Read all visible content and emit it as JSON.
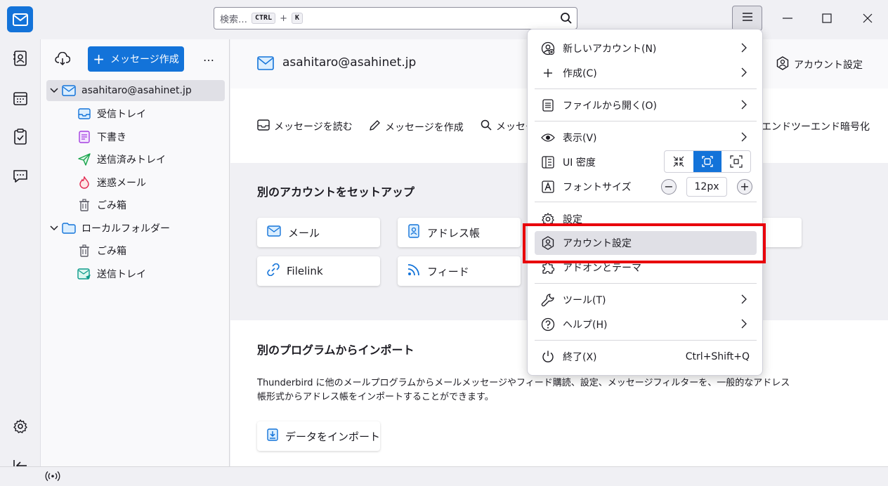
{
  "search": {
    "placeholder": "検索…",
    "key1": "CTRL",
    "plus": "+",
    "key2": "K"
  },
  "folder_pane": {
    "compose_label": "メッセージ作成",
    "more_label": "…",
    "account": "asahitaro@asahinet.jp",
    "folders": [
      {
        "label": "受信トレイ",
        "icon": "inbox-icon"
      },
      {
        "label": "下書き",
        "icon": "drafts-icon"
      },
      {
        "label": "送信済みトレイ",
        "icon": "sent-icon"
      },
      {
        "label": "迷惑メール",
        "icon": "junk-icon"
      },
      {
        "label": "ごみ箱",
        "icon": "trash-icon"
      }
    ],
    "local": "ローカルフォルダー",
    "local_folders": [
      {
        "label": "ごみ箱",
        "icon": "trash-icon"
      },
      {
        "label": "送信トレイ",
        "icon": "outbox-icon"
      }
    ]
  },
  "main": {
    "account_email": "asahitaro@asahinet.jp",
    "account_settings": "アカウント設定",
    "actions": {
      "read": "メッセージを読む",
      "compose": "メッセージを作成",
      "search": "メッセー",
      "e2e": "エンドツーエンド暗号化"
    },
    "setup_title": "別のアカウントをセットアップ",
    "setup_cards": {
      "mail": "メール",
      "addressbook": "アドレス帳",
      "filelink": "Filelink",
      "feed": "フィード"
    },
    "import_title": "別のプログラムからインポート",
    "import_desc_1": "Thunderbird に他のメールプログラムからメールメッセージやフィード購読、設定、メッセージフィルターを、一般的なアドレス",
    "import_desc_2": "帳形式からアドレス帳をインポートすることができます。",
    "import_button": "データをインポート"
  },
  "app_menu": {
    "new_account": "新しいアカウント(N)",
    "new": "作成(C)",
    "open_file": "ファイルから開く(O)",
    "view": "表示(V)",
    "ui_density": "UI 密度",
    "font_size": "フォントサイズ",
    "font_size_value": "12px",
    "font_minus": "−",
    "font_plus": "+",
    "settings": "設定",
    "account_settings": "アカウント設定",
    "addons": "アドオンとテーマ",
    "tools": "ツール(T)",
    "help": "ヘルプ(H)",
    "quit": "終了(X)",
    "quit_shortcut": "Ctrl+Shift+Q"
  },
  "colors": {
    "accent": "#1373d9",
    "highlight": "#e8000b"
  }
}
